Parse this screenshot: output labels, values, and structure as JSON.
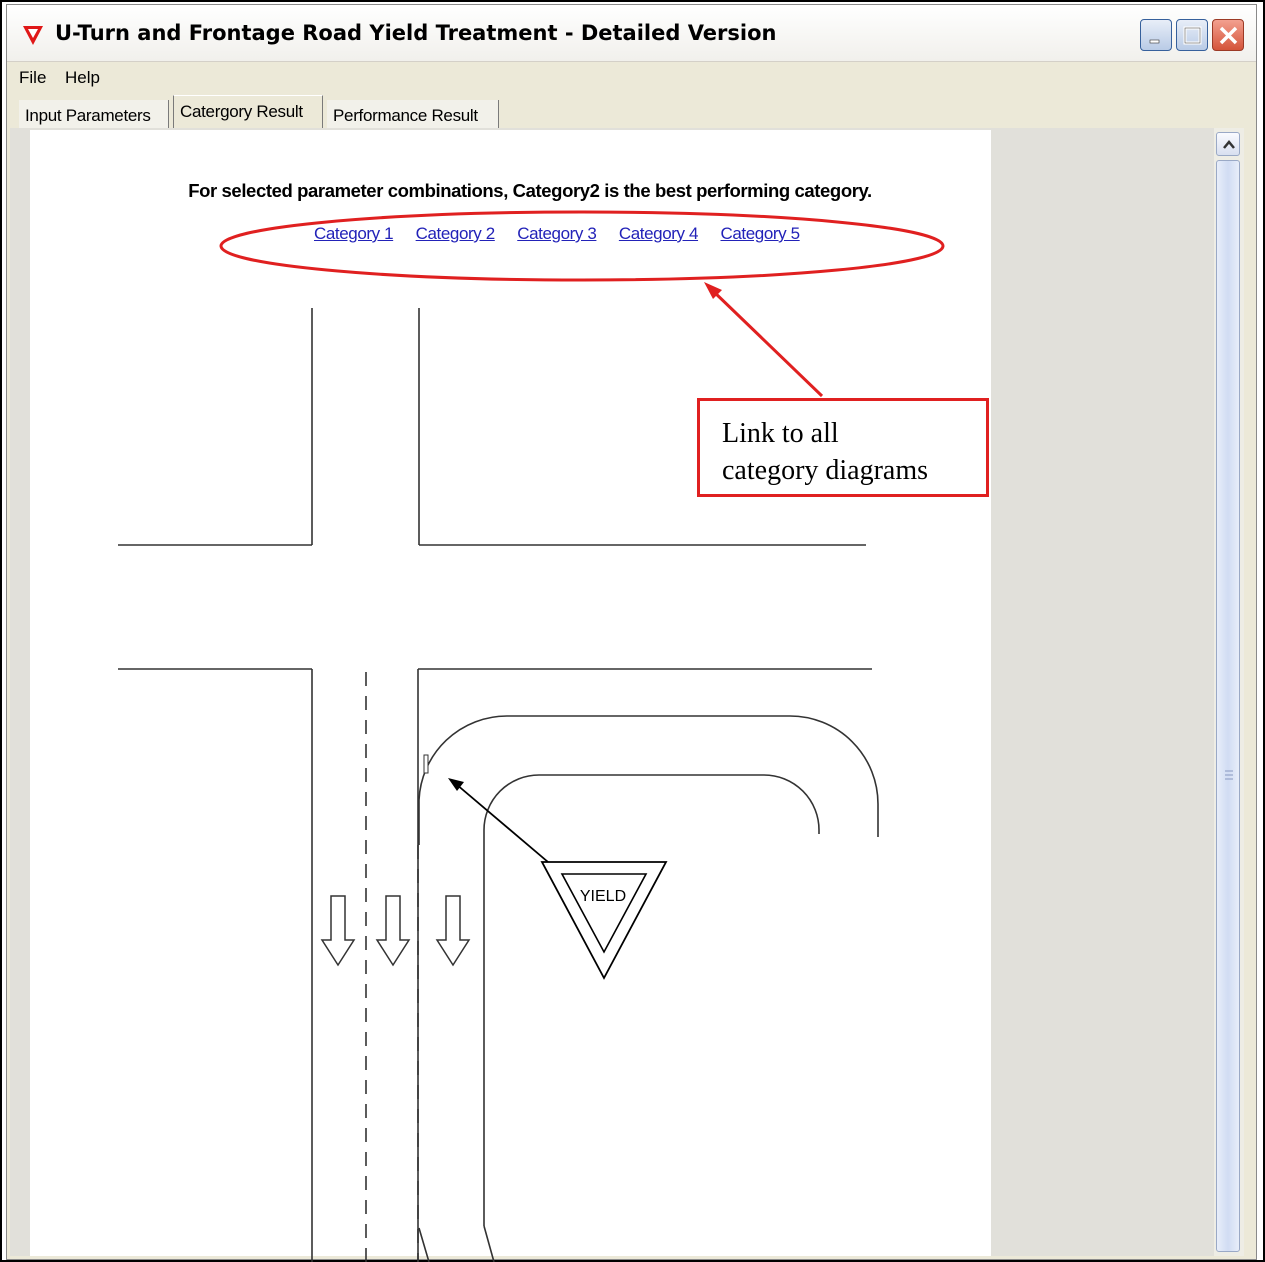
{
  "window": {
    "title": "U-Turn and Frontage Road Yield Treatment - Detailed Version",
    "accent_color": "#e02020"
  },
  "menu": {
    "items": [
      "File",
      "Help"
    ]
  },
  "tabs": [
    {
      "label": "Input Parameters",
      "active": false
    },
    {
      "label": "Catergory Result",
      "active": true
    },
    {
      "label": "Performance Result",
      "active": false
    }
  ],
  "content": {
    "heading": "For selected parameter combinations, Category2 is the best performing category.",
    "category_links": [
      "Category 1",
      "Category 2",
      "Category 3",
      "Category 4",
      "Category 5"
    ],
    "yield_sign_text": "YIELD"
  },
  "annotation": {
    "line1": "Link to all",
    "line2": "category diagrams"
  }
}
